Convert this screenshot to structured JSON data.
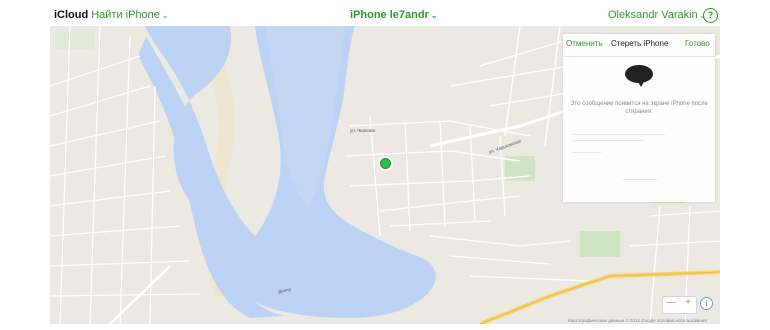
{
  "topbar": {
    "brand": "iCloud",
    "app_name": "Найти iPhone",
    "device_name": "iPhone le7andr",
    "user_name": "Oleksandr Varakin",
    "help_symbol": "?",
    "chevron": "⌄"
  },
  "erase_panel": {
    "cancel_label": "Отменить",
    "title": "Стереть iPhone",
    "done_label": "Готово",
    "message": "Это сообщение появится на экране iPhone после стирания."
  },
  "map": {
    "water_color": "#bcd3f5",
    "land_color": "#ece9e2",
    "road_color": "#ffffff",
    "highway_color": "#f5d36b",
    "park_color": "#cfe6c2",
    "pin_color": "#2bbf45",
    "street_labels": [
      "ул. Чкалова",
      "ул. Харьковская",
      "Днепр"
    ],
    "attribution": "Картографические данные © 2014 Google   Условия использования"
  },
  "map_controls": {
    "zoom_out": "—",
    "zoom_in": "+",
    "info": "i"
  }
}
